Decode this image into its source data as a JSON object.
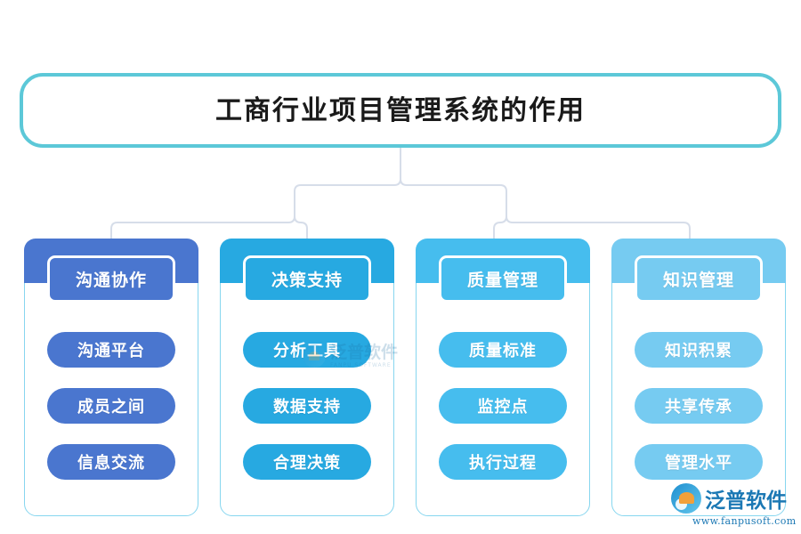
{
  "title": {
    "text": "工商行业项目管理系统的作用",
    "border_color": "#5cc8d8"
  },
  "columns": [
    {
      "id": "communication-collaboration",
      "header": "沟通协作",
      "color": "#4a76cf",
      "items": [
        "沟通平台",
        "成员之间",
        "信息交流"
      ]
    },
    {
      "id": "decision-support",
      "header": "决策支持",
      "color": "#27a9e1",
      "items": [
        "分析工具",
        "数据支持",
        "合理决策"
      ]
    },
    {
      "id": "quality-management",
      "header": "质量管理",
      "color": "#46bdee",
      "items": [
        "质量标准",
        "监控点",
        "执行过程"
      ]
    },
    {
      "id": "knowledge-management",
      "header": "知识管理",
      "color": "#76cbf1",
      "items": [
        "知识积累",
        "共享传承",
        "管理水平"
      ]
    }
  ],
  "watermark": {
    "brand_cn": "泛普软件",
    "brand_en": "FANPU SOFTWARE"
  },
  "logo": {
    "brand_cn": "泛普软件",
    "url": "www.fanpusoft.com",
    "color": "#1b78b4"
  },
  "connector": {
    "color": "#d6dde9"
  }
}
